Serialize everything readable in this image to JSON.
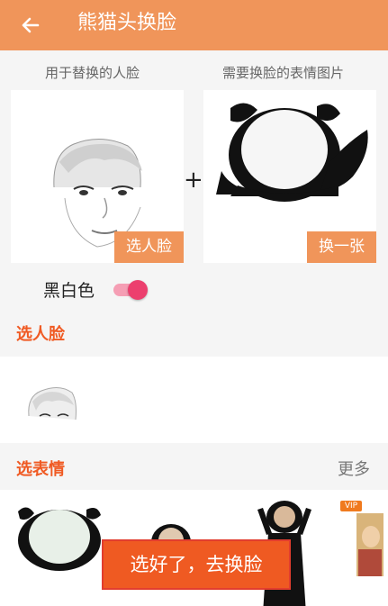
{
  "header": {
    "title": "熊猫头换脸"
  },
  "sections": {
    "face_label": "用于替换的人脸",
    "meme_label": "需要换脸的表情图片"
  },
  "buttons": {
    "choose_face": "选人脸",
    "change_one": "换一张",
    "confirm": "选好了，去换脸"
  },
  "toggle": {
    "label": "黑白色",
    "on": true
  },
  "face_section": {
    "heading": "选人脸"
  },
  "meme_section": {
    "heading": "选表情",
    "more": "更多"
  },
  "stickers": {
    "vip_badge": "VIP"
  }
}
